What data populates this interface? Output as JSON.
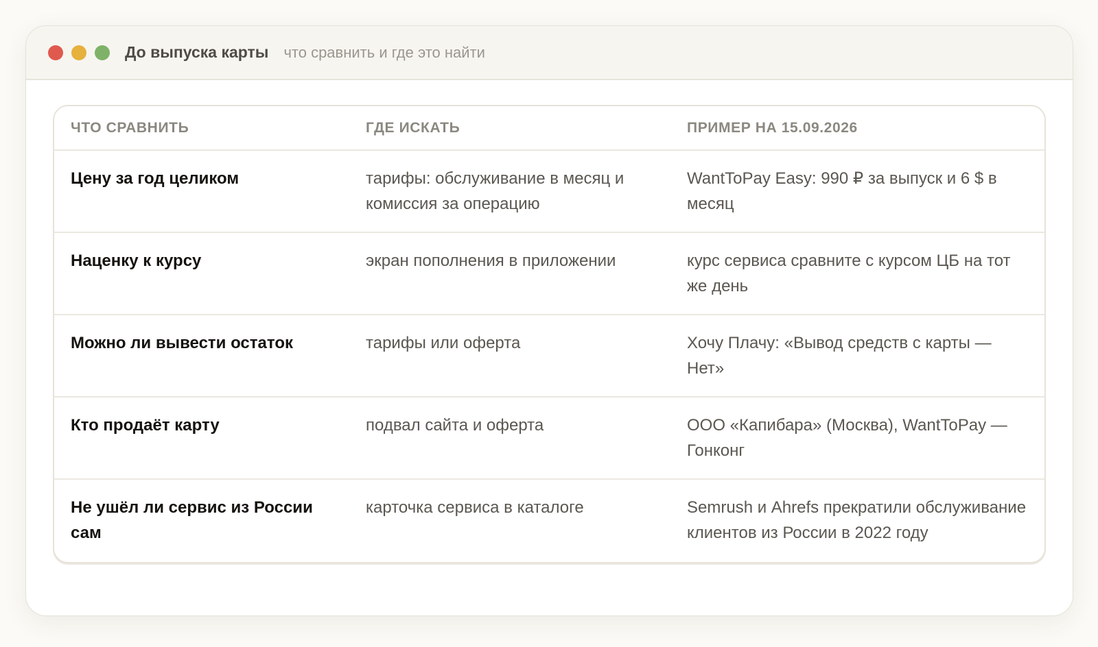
{
  "window": {
    "title": "До выпуска карты",
    "subtitle": "что сравнить и где это найти"
  },
  "table": {
    "columns": [
      "ЧТО СРАВНИТЬ",
      "ГДЕ ИСКАТЬ",
      "ПРИМЕР НА 15.09.2026"
    ],
    "rows": [
      {
        "what": "Цену за год целиком",
        "where": "тарифы: обслуживание в месяц и комиссия за операцию",
        "example": "WantToPay Easy: 990 ₽ за выпуск и 6 $ в месяц"
      },
      {
        "what": "Наценку к курсу",
        "where": "экран пополнения в приложении",
        "example": "курс сервиса сравните с курсом ЦБ на тот же день"
      },
      {
        "what": "Можно ли вывести остаток",
        "where": "тарифы или оферта",
        "example": "Хочу Плачу: «Вывод средств с карты — Нет»"
      },
      {
        "what": "Кто продаёт карту",
        "where": "подвал сайта и оферта",
        "example": "ООО «Капибара» (Москва), WantToPay — Гонконг"
      },
      {
        "what": "Не ушёл ли сервис из России сам",
        "where": "карточка сервиса в каталоге",
        "example": "Semrush и Ahrefs прекратили обслуживание клиентов из России в 2022 году"
      }
    ]
  }
}
